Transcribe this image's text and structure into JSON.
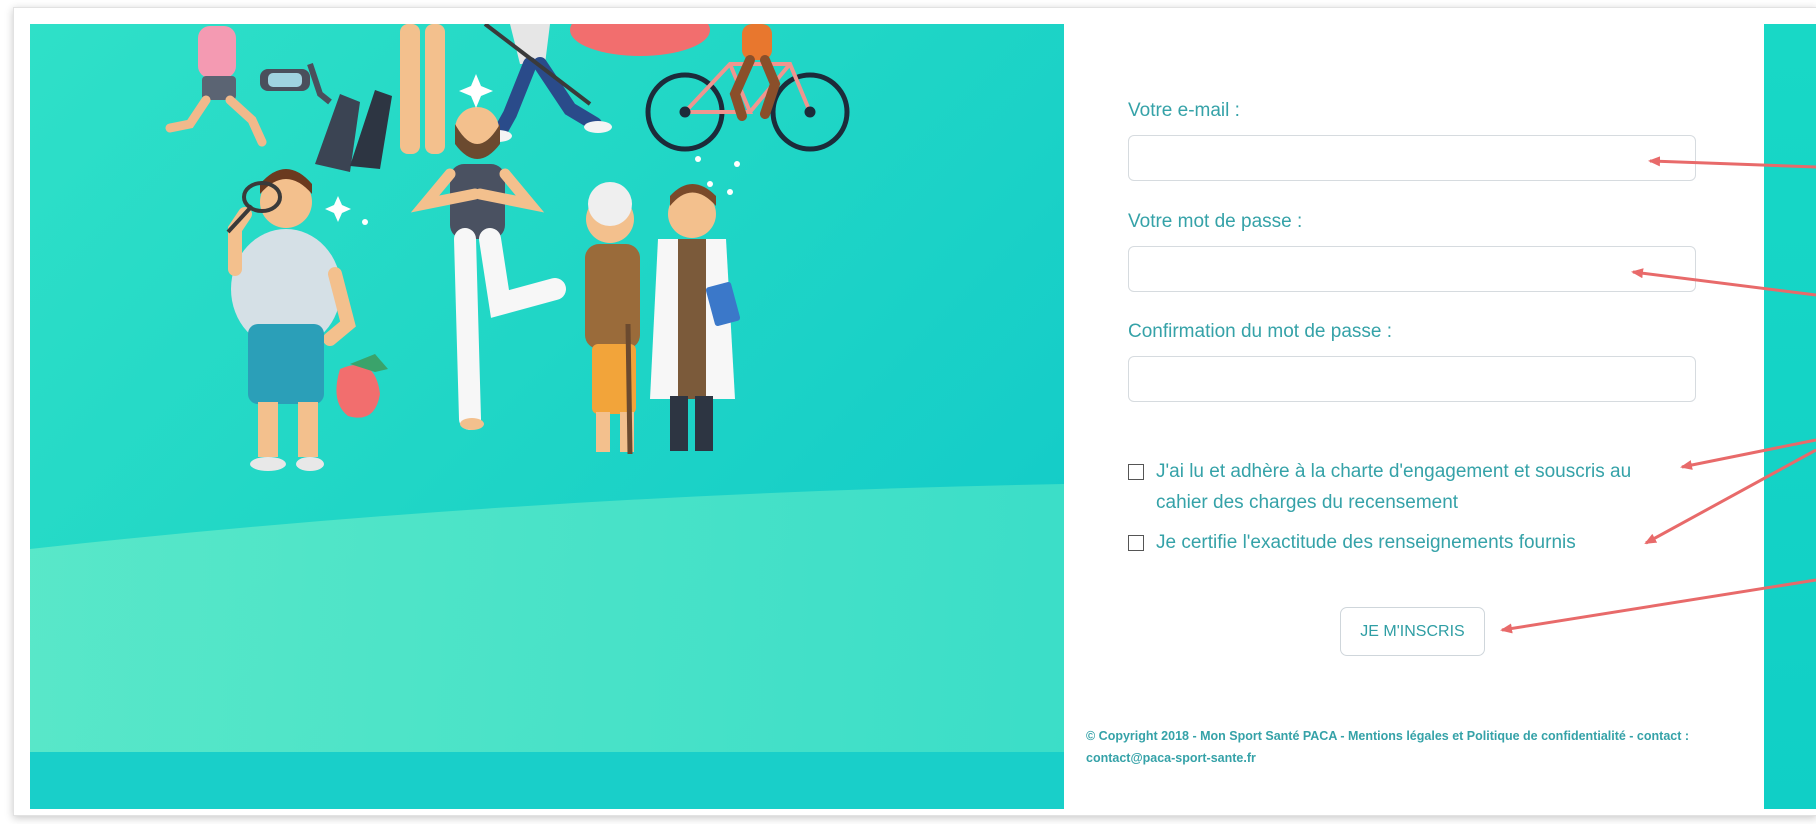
{
  "form": {
    "email_label": "Votre e-mail :",
    "email_value": "",
    "password_label": "Votre mot de passe :",
    "password_value": "",
    "confirm_label": "Confirmation du mot de passe :",
    "confirm_value": "",
    "charter_checkbox_label": "J'ai lu et adhère à la charte d'engagement et souscris au cahier des charges du recensement",
    "certify_checkbox_label": "Je certifie l'exactitude des renseignements fournis",
    "submit_label": "JE M'INSCRIS"
  },
  "footer": {
    "copyright_text": "© Copyright 2018 - Mon Sport Santé PACA - Mentions légales et Politique de confidentialité - contact : contact@paca-sport-sante.fr"
  },
  "colors": {
    "hero_teal": "#20d6c6",
    "label_teal": "#35a2a8",
    "annotation_arrow": "#e86a6a"
  }
}
